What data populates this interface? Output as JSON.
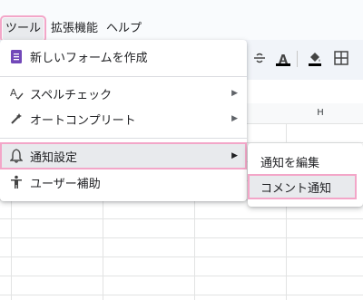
{
  "menubar": {
    "tools": "ツール",
    "extensions": "拡張機能",
    "help": "ヘルプ"
  },
  "toolbar": {
    "text_color_letter": "A"
  },
  "sheet": {
    "column_h": "H"
  },
  "tools_menu": {
    "items": [
      {
        "label": "新しいフォームを作成",
        "icon": "form-icon"
      },
      {
        "label": "スペルチェック",
        "icon": "spellcheck-icon",
        "has_submenu": true
      },
      {
        "label": "オートコンプリート",
        "icon": "autocomplete-wand-icon",
        "has_submenu": true
      },
      {
        "label": "通知設定",
        "icon": "bell-icon",
        "has_submenu": true
      },
      {
        "label": "ユーザー補助",
        "icon": "accessibility-icon"
      }
    ]
  },
  "notification_submenu": {
    "items": [
      {
        "label": "通知を編集"
      },
      {
        "label": "コメント通知"
      }
    ]
  },
  "colors": {
    "highlight_outline": "#f3a6c8",
    "form_icon": "#7248b9"
  }
}
